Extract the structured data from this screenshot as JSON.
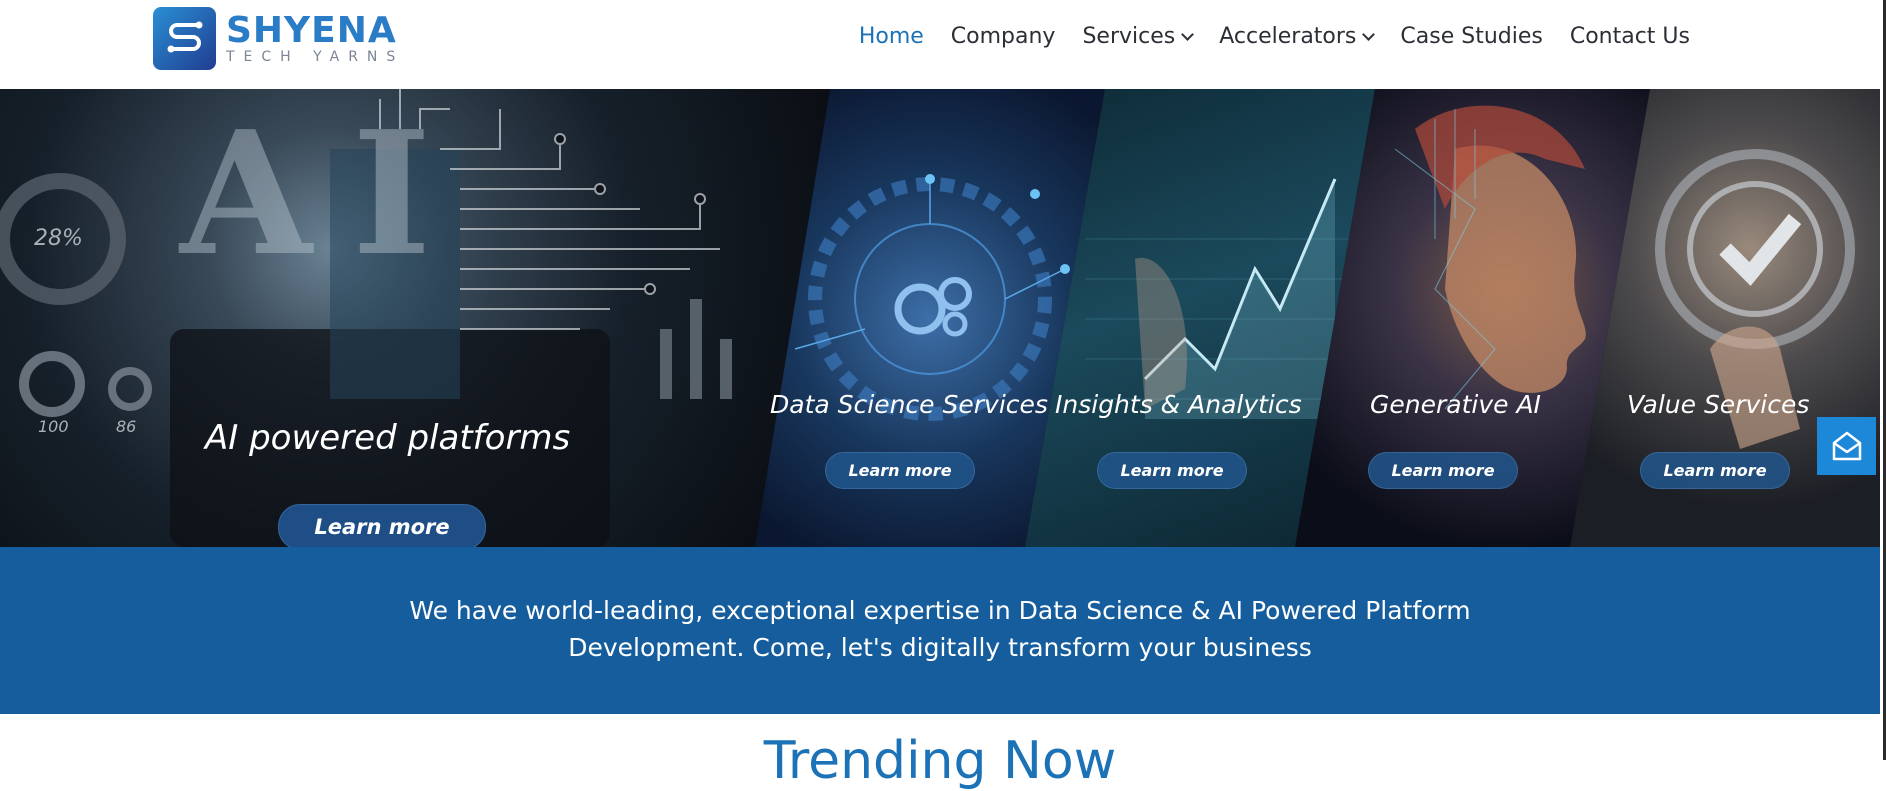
{
  "brand": {
    "name": "SHYENA",
    "tagline": "TECH YARNS",
    "logo_icon": "circuit-s-logo-icon",
    "primary_color": "#1c72b6",
    "band_color": "#155d9c"
  },
  "nav": {
    "items": [
      {
        "label": "Home",
        "active": true,
        "has_dropdown": false
      },
      {
        "label": "Company",
        "active": false,
        "has_dropdown": false
      },
      {
        "label": "Services",
        "active": false,
        "has_dropdown": true
      },
      {
        "label": "Accelerators",
        "active": false,
        "has_dropdown": true
      },
      {
        "label": "Case Studies",
        "active": false,
        "has_dropdown": false
      },
      {
        "label": "Contact Us",
        "active": false,
        "has_dropdown": false
      }
    ]
  },
  "hero": {
    "panels": [
      {
        "title": "AI powered platforms",
        "button": "Learn more"
      },
      {
        "title": "Data Science Services",
        "button": "Learn more"
      },
      {
        "title": "Insights & Analytics",
        "button": "Learn more"
      },
      {
        "title": "Generative AI",
        "button": "Learn more"
      },
      {
        "title": "Value Services",
        "button": "Learn more"
      }
    ],
    "overlay_text": {
      "big_letters": "AI",
      "gauge_value": "28%",
      "stat_1": "100",
      "stat_2": "86"
    }
  },
  "floating": {
    "contact_icon": "mail-open-icon"
  },
  "tagline_band": {
    "text": "We have world-leading, exceptional expertise in Data Science & AI Powered Platform Development. Come, let's digitally transform your business"
  },
  "section": {
    "title": "Trending Now"
  }
}
